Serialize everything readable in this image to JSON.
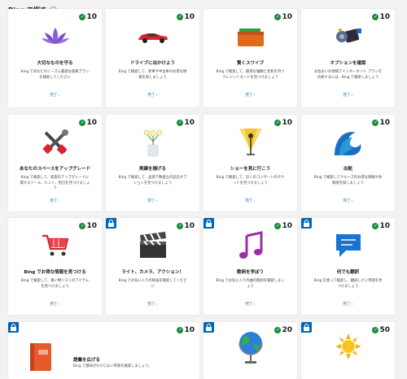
{
  "header": {
    "title": "Bing で探す",
    "info_icon": "info-icon"
  },
  "cards": [
    {
      "id": "c1",
      "points": "10",
      "title": "大切なものを守る",
      "desc": "Bing であなたのニーズに最適な保険プランを検索してください",
      "link": "完了 ›",
      "icon": "lotus-icon",
      "locked": false
    },
    {
      "id": "c2",
      "points": "10",
      "title": "ドライブに出かけよう",
      "desc": "Bing で検索して、新車や中古車のお得な情報を探しましょう",
      "link": "完了 ›",
      "icon": "car-icon",
      "locked": false
    },
    {
      "id": "c3",
      "points": "10",
      "title": "賢くスワイプ",
      "desc": "Bing で検索して、最適な報酬と金利を持つクレジットカードを見つけましょう",
      "link": "完了 ›",
      "icon": "wallet-icon",
      "locked": false
    },
    {
      "id": "c4",
      "points": "10",
      "title": "オプションを確認",
      "desc": "お住まいの地域でインターネット プランを比較するには、Bing で検索しましょう",
      "link": "完了 ›",
      "icon": "satellite-icon",
      "locked": false
    },
    {
      "id": "c5",
      "points": "10",
      "title": "あなたのスペースをアップグレード",
      "desc": "Bing で検索して、家族のアップグレードに関するツール、ヒント、指引を見つけましょう",
      "link": "完了 ›",
      "icon": "tools-icon",
      "locked": false
    },
    {
      "id": "c6",
      "points": "10",
      "title": "実績を揚げる",
      "desc": "Bing で検索して、品達で数値立の記念オプションを見つけましょう",
      "link": "完了 ›",
      "icon": "flower-vase-icon",
      "locked": false
    },
    {
      "id": "c7",
      "points": "10",
      "title": "ショーを見に行こう",
      "desc": "Bing で検索して、近くのコンサートのチケットを見つけましょう",
      "link": "完了 ›",
      "icon": "microphone-icon",
      "locked": false
    },
    {
      "id": "c8",
      "points": "10",
      "title": "出航",
      "desc": "Bing で検索してクルーズのお得な情報や休暇地を探しましょう",
      "link": "完了 ›",
      "icon": "wave-icon",
      "locked": false
    },
    {
      "id": "c9",
      "points": "10",
      "title": "Bing でお得な情報を見つける",
      "desc": "Bing で検索して、買い物リストのアイテムを見つけましょう",
      "link": "完了 ›",
      "icon": "cart-icon",
      "locked": false
    },
    {
      "id": "c10",
      "points": "10",
      "title": "ライト、カメラ、アクション！",
      "desc": "Bing でお気に入りの映画を検索してください",
      "link": "完了 ›",
      "icon": "clapperboard-icon",
      "locked": true
    },
    {
      "id": "c11",
      "points": "10",
      "title": "歌詞を学ぼう",
      "desc": "Bing でお気に入りの曲の歌詞を検索しましょう",
      "link": "完了 ›",
      "icon": "music-note-icon",
      "locked": true
    },
    {
      "id": "c12",
      "points": "10",
      "title": "何でも翻訳",
      "desc": "Bing を使って検索し、翻訳したい単語を見つけましょう",
      "link": "完了 ›",
      "icon": "chat-bubble-icon",
      "locked": true
    },
    {
      "id": "c13",
      "points": "10",
      "title": "語彙を広げる",
      "desc": "Bing で意味がわからない単語を検索しましょう。",
      "link": "",
      "icon": "book-icon",
      "locked": true
    },
    {
      "id": "c14",
      "points": "20",
      "title": "",
      "desc": "",
      "link": "",
      "icon": "globe-icon",
      "locked": true
    },
    {
      "id": "c15",
      "points": "50",
      "title": "",
      "desc": "",
      "link": "",
      "icon": "sun-icon",
      "locked": true
    }
  ]
}
